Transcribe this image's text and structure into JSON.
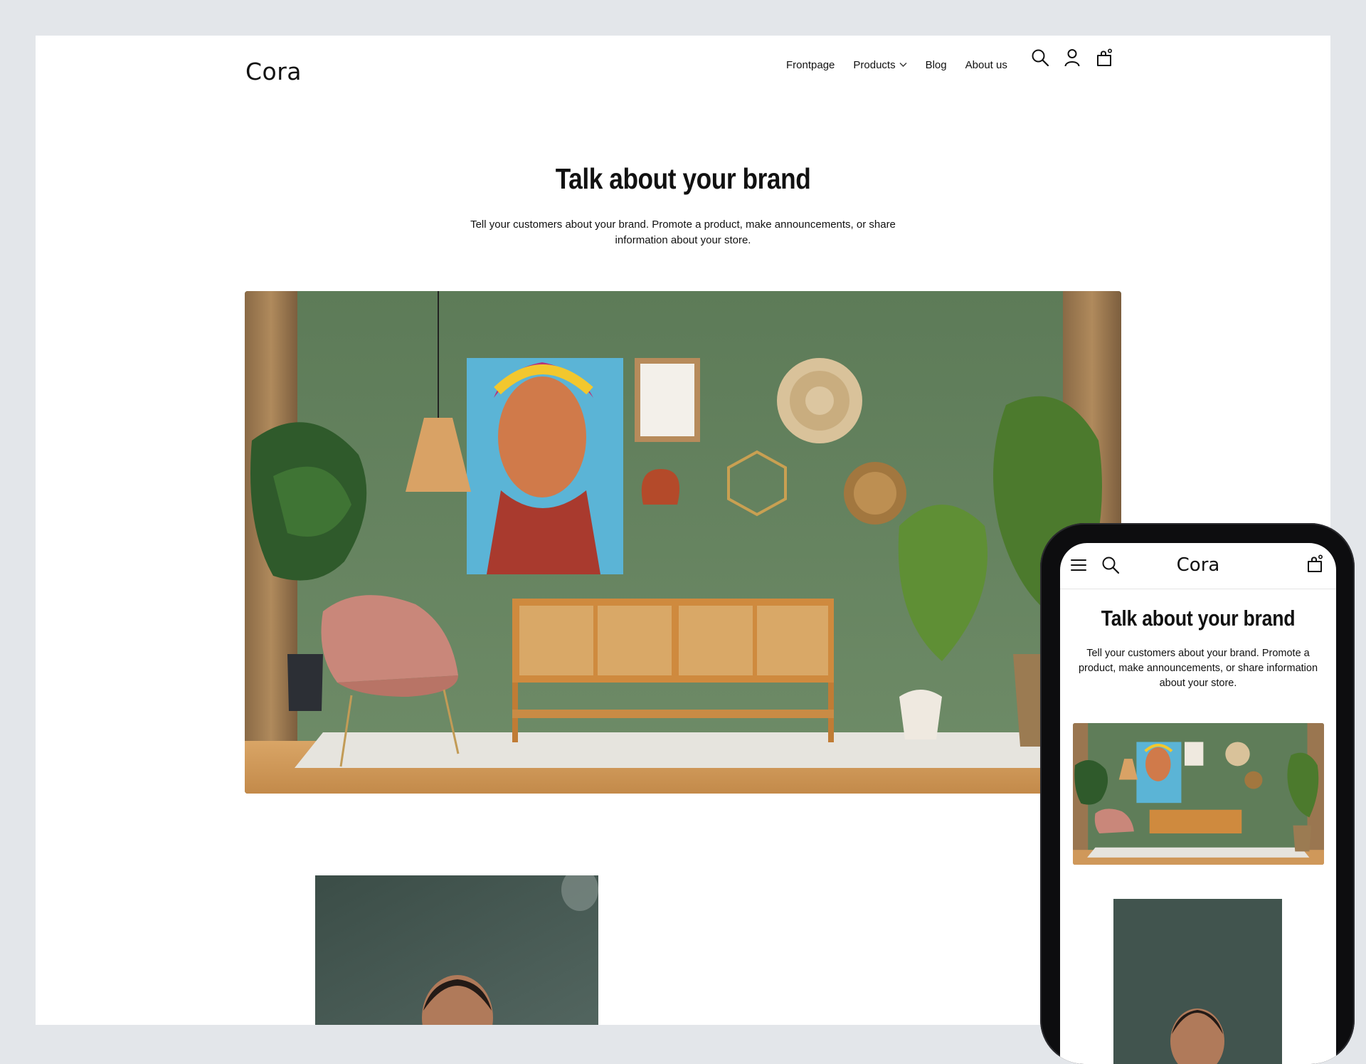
{
  "site": {
    "logo": "Cora"
  },
  "nav": {
    "items": [
      {
        "label": "Frontpage"
      },
      {
        "label": "Products"
      },
      {
        "label": "Blog"
      },
      {
        "label": "About us"
      }
    ],
    "icons": [
      "search-icon",
      "account-icon",
      "cart-icon"
    ]
  },
  "hero": {
    "title": "Talk about your brand",
    "text": "Tell your customers about your brand. Promote a product, make announcements, or share information about your store."
  },
  "mobile": {
    "logo": "Cora",
    "title": "Talk about your brand",
    "text": "Tell your customers about your brand. Promote a product, make announcements, or share information about your store.",
    "icons": [
      "menu-icon",
      "search-icon",
      "cart-icon"
    ]
  },
  "colors": {
    "background": "#e3e6ea",
    "page": "#ffffff",
    "wall_green": "#5f7f5c",
    "phone_frame": "#0d0d0f"
  }
}
